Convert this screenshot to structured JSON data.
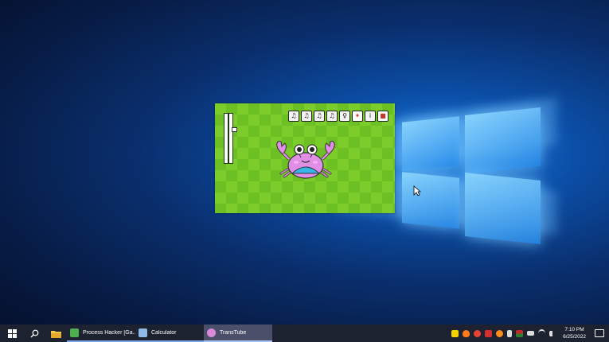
{
  "desktop": {
    "wallpaper": "windows-10-hero",
    "accent_color": "#1e7fe0"
  },
  "game": {
    "toolbar_buttons": [
      {
        "icon": "music-note-icon",
        "glyph": "♫"
      },
      {
        "icon": "music-note-icon",
        "glyph": "♫"
      },
      {
        "icon": "music-note-icon",
        "glyph": "♫"
      },
      {
        "icon": "music-note-icon",
        "glyph": "♫"
      },
      {
        "icon": "fish-icon",
        "glyph": "♀"
      },
      {
        "icon": "red-item-icon",
        "glyph": "✦"
      },
      {
        "icon": "info-icon",
        "glyph": "i"
      },
      {
        "icon": "book-icon",
        "glyph": "■"
      }
    ],
    "board_colors": {
      "light": "#7ccd2c",
      "dark": "#6cc023"
    },
    "character": "crab"
  },
  "taskbar": {
    "apps": [
      {
        "label": "Process Hacker [Ga...",
        "icon": "process-hacker-icon",
        "color": "#4caf50",
        "active": false
      },
      {
        "label": "Calculator",
        "icon": "calculator-icon",
        "color": "#8fb9e6",
        "active": false
      },
      {
        "label": "TransTube",
        "icon": "crab-icon",
        "color": "#d98ad8",
        "active": true
      }
    ],
    "clock": {
      "time": "7:10 PM",
      "date": "6/25/2022"
    },
    "tray_icons": [
      {
        "icon": "yellow-chat-icon",
        "color": "#f5d300"
      },
      {
        "icon": "flame-icon",
        "color": "#ff7a1a"
      },
      {
        "icon": "chrome-icon",
        "color": "#e94235"
      },
      {
        "icon": "shield-icon",
        "color": "#d32f2f"
      },
      {
        "icon": "key-icon",
        "color": "#ff8c1a"
      },
      {
        "icon": "usb-icon",
        "color": "#dddddd"
      },
      {
        "icon": "bars-icon",
        "color": "#c62828"
      },
      {
        "icon": "battery-icon",
        "color": "#dddddd"
      },
      {
        "icon": "wifi-icon",
        "color": "#dddddd"
      },
      {
        "icon": "volume-icon",
        "color": "#dddddd"
      }
    ]
  }
}
